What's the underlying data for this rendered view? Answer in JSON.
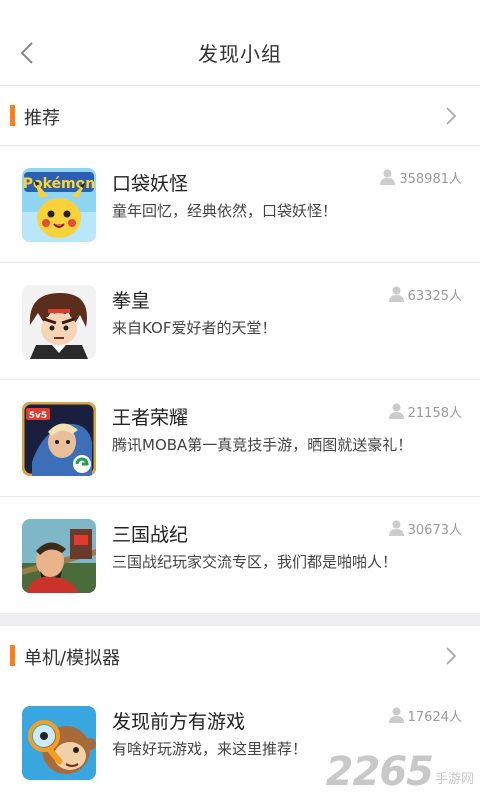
{
  "header": {
    "title": "发现小组",
    "back_icon": "chevron-left-icon"
  },
  "sections": [
    {
      "title": "推荐",
      "accent": "#ff7e1a",
      "more_icon": "chevron-right-icon",
      "items": [
        {
          "name": "口袋妖怪",
          "desc": "童年回忆，经典依然，口袋妖怪！",
          "count": "358981人",
          "thumb_icon": "pokemon-thumbnail-icon"
        },
        {
          "name": "拳皇",
          "desc": "来自KOF爱好者的天堂！",
          "count": "63325人",
          "thumb_icon": "kof-thumbnail-icon"
        },
        {
          "name": "王者荣耀",
          "desc": "腾讯MOBA第一真竞技手游，晒图就送豪礼！",
          "count": "21158人",
          "thumb_icon": "honor-of-kings-thumbnail-icon"
        },
        {
          "name": "三国战纪",
          "desc": "三国战纪玩家交流专区，我们都是啪啪人！",
          "count": "30673人",
          "thumb_icon": "three-kingdoms-thumbnail-icon"
        }
      ]
    },
    {
      "title": "单机/模拟器",
      "accent": "#ff7e1a",
      "more_icon": "chevron-right-icon",
      "items": [
        {
          "name": "发现前方有游戏",
          "desc": "有啥好玩游戏，来这里推荐！",
          "count": "17624人",
          "thumb_icon": "monkey-magnifier-thumbnail-icon"
        }
      ]
    }
  ],
  "watermark": {
    "digits": "2265",
    "text": "手游网"
  }
}
